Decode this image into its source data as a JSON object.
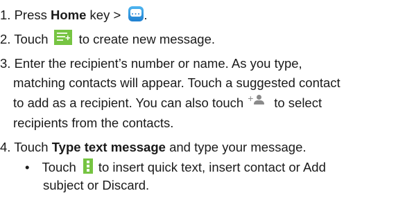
{
  "steps": {
    "s1": {
      "a": "1. Press ",
      "b": "Home",
      "c": " key > ",
      "d": "."
    },
    "s2": {
      "a": "2. Touch",
      "b": "to create new message."
    },
    "s3": {
      "l1": "3. Enter the recipient’s number or name. As you type,",
      "l2": "matching contacts will appear. Touch a suggested contact",
      "l3a": "to add as a recipient. You can also touch",
      "l3b": "to select",
      "l4": "recipients from the contacts."
    },
    "s4": {
      "a": "4. Touch ",
      "b": "Type text message",
      "c": " and type your message."
    },
    "bullet": {
      "mark": "•",
      "a": "Touch",
      "b": "to insert quick text, insert contact or Add",
      "c": "subject or Discard."
    }
  },
  "icons": {
    "home_app": "messaging-app-icon",
    "new_message": "new-message-icon",
    "add_contact": "add-contact-icon",
    "menu": "menu-dots-icon"
  }
}
